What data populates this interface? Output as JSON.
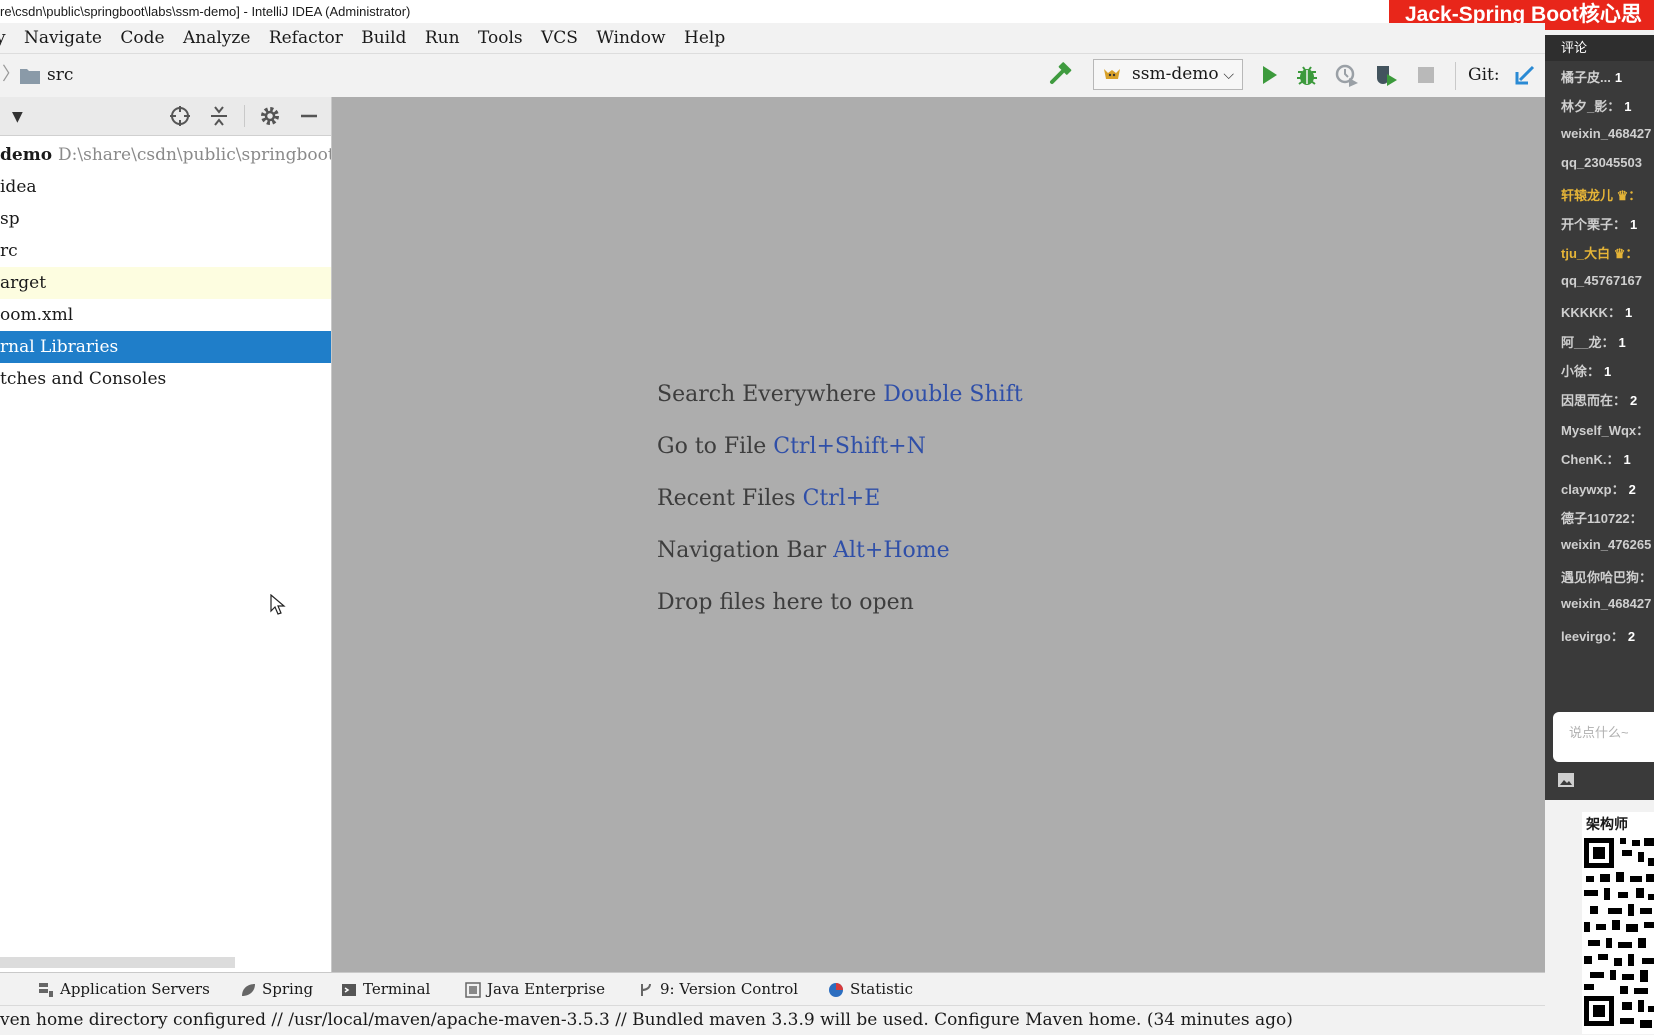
{
  "window": {
    "title": "re\\csdn\\public\\springboot\\labs\\ssm-demo] - IntelliJ IDEA (Administrator)",
    "banner": "Jack-Spring Boot核心思"
  },
  "menu": {
    "items": [
      "y",
      "Navigate",
      "Code",
      "Analyze",
      "Refactor",
      "Build",
      "Run",
      "Tools",
      "VCS",
      "Window",
      "Help"
    ]
  },
  "navbar": {
    "crumb": "src",
    "run_config": "ssm-demo",
    "git_label": "Git:"
  },
  "project_tree": {
    "root_name": "demo",
    "root_path": "D:\\share\\csdn\\public\\springboot\\l",
    "rows": [
      {
        "label": "idea"
      },
      {
        "label": "sp"
      },
      {
        "label": "rc"
      },
      {
        "label": "arget"
      },
      {
        "label": "oom.xml"
      },
      {
        "label": "rnal Libraries"
      },
      {
        "label": "tches and Consoles"
      }
    ]
  },
  "editor_hints": [
    {
      "text": "Search Everywhere",
      "key": "Double Shift"
    },
    {
      "text": "Go to File",
      "key": "Ctrl+Shift+N"
    },
    {
      "text": "Recent Files",
      "key": "Ctrl+E"
    },
    {
      "text": "Navigation Bar",
      "key": "Alt+Home"
    },
    {
      "text": "Drop files here to open",
      "key": ""
    }
  ],
  "bottom_tools": [
    {
      "label": "Application Servers",
      "icon": "server-icon"
    },
    {
      "label": "Spring",
      "icon": "spring-leaf-icon"
    },
    {
      "label": "Terminal",
      "icon": "terminal-icon"
    },
    {
      "label": "Java Enterprise",
      "icon": "java-enterprise-icon"
    },
    {
      "label": "9: Version Control",
      "icon": "version-control-icon"
    },
    {
      "label": "Statistic",
      "icon": "statistic-icon"
    }
  ],
  "status": {
    "message": "ven home directory configured // /usr/local/maven/apache-maven-3.5.3 // Bundled maven 3.3.9 will be used.  Configure Maven home.  (34 minutes ago)"
  },
  "comments": {
    "title": "评论",
    "items": [
      {
        "user": "橘子皮...",
        "value": "1",
        "gold": false
      },
      {
        "user": "林夕_影：",
        "value": "1",
        "gold": false
      },
      {
        "user": "weixin_468427",
        "value": "",
        "gold": false
      },
      {
        "user": "qq_23045503",
        "value": "",
        "gold": false
      },
      {
        "user": "轩辕龙儿 ♛：",
        "value": "",
        "gold": true
      },
      {
        "user": "开个栗子：",
        "value": "1",
        "gold": false
      },
      {
        "user": "tju_大白 ♛：",
        "value": "",
        "gold": true
      },
      {
        "user": "qq_45767167",
        "value": "",
        "gold": false
      },
      {
        "user": "KKKKK：",
        "value": "1",
        "gold": false
      },
      {
        "user": "阿__龙：",
        "value": "1",
        "gold": false
      },
      {
        "user": "小徐：",
        "value": "1",
        "gold": false
      },
      {
        "user": "因思而在：",
        "value": "2",
        "gold": false
      },
      {
        "user": "Myself_Wqx：",
        "value": "",
        "gold": false
      },
      {
        "user": "ChenK.：",
        "value": "1",
        "gold": false
      },
      {
        "user": "claywxp：",
        "value": "2",
        "gold": false
      },
      {
        "user": "德子110722：",
        "value": "",
        "gold": false
      },
      {
        "user": "weixin_476265",
        "value": "",
        "gold": false
      },
      {
        "user": "遇见你哈巴狗：",
        "value": "",
        "gold": false
      },
      {
        "user": "weixin_468427",
        "value": "",
        "gold": false
      },
      {
        "user": "leevirgo：",
        "value": "2",
        "gold": false
      }
    ],
    "input_placeholder": "说点什么~"
  },
  "qr": {
    "title": "架构师"
  }
}
